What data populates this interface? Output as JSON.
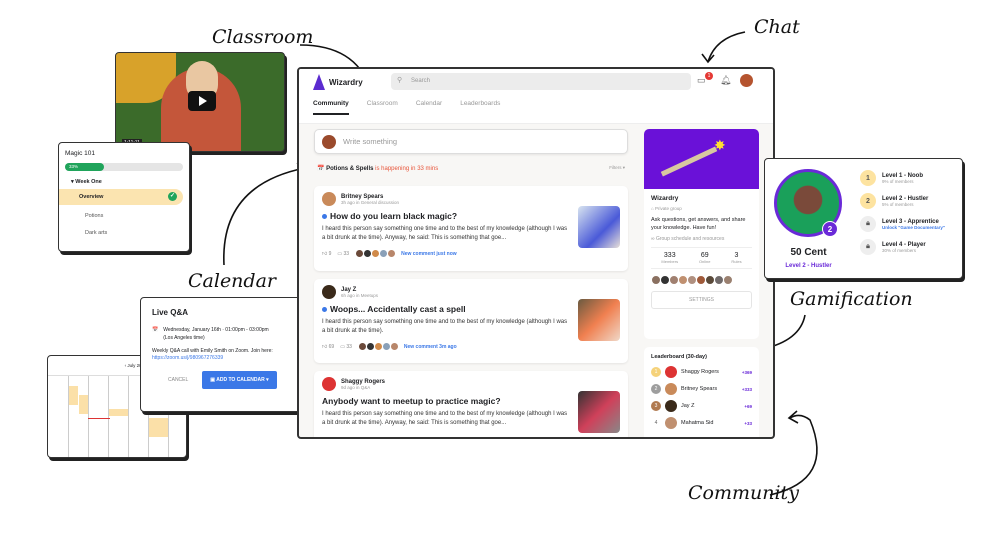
{
  "annotations": {
    "classroom": "Classroom",
    "chat": "Chat",
    "calendar": "Calendar",
    "gamification": "Gamification",
    "community": "Community"
  },
  "video": {
    "duration": "1:11:11"
  },
  "course": {
    "title": "Magic 101",
    "progress_percent": 33,
    "progress_label": "33%",
    "section": "Week One",
    "lessons": [
      {
        "label": "Overview",
        "done": true
      },
      {
        "label": "Potions",
        "done": false
      },
      {
        "label": "Dark arts",
        "done": false
      }
    ]
  },
  "mini_calendar": {
    "month": "July 2021"
  },
  "event_popup": {
    "title": "Live Q&A",
    "datetime": "Wednesday, January 16th · 01:00pm - 03:00pm",
    "timezone": "(Los Angeles time)",
    "description": "Weekly Q&A call with Emily Smith on Zoom. Join here:",
    "link": "https://zoom.us/j/980967276339",
    "cancel": "CANCEL",
    "add": "ADD TO CALENDAR",
    "accent": "#3b78e7"
  },
  "app": {
    "name": "Wizardry",
    "search_placeholder": "Search",
    "chat_badge": "1",
    "tabs": [
      "Community",
      "Classroom",
      "Calendar",
      "Leaderboards"
    ],
    "active_tab": "Community",
    "composer_placeholder": "Write something",
    "event_banner": {
      "name": "Potions & Spells",
      "status": "is happening in 33 mins",
      "filters": "Filters"
    },
    "posts": [
      {
        "author": "Britney Spears",
        "meta": "3h ago in General discussion",
        "title": "How do you learn black magic?",
        "unread": true,
        "body": "I heard this person say something one time and to the best of my knowledge (although I was a bit drunk at the time). Anyway, he said: This is something that goe...",
        "likes": "9",
        "comments": "33",
        "activity": "New comment just now"
      },
      {
        "author": "Jay Z",
        "meta": "6h ago in Meetups",
        "title": "Woops... Accidentally cast a spell",
        "unread": true,
        "body": "I heard this person say something one time and to the best of my knowledge (although I was a bit drunk at the time).",
        "likes": "69",
        "comments": "33",
        "activity": "New comment 3m ago"
      },
      {
        "author": "Shaggy Rogers",
        "meta": "9d ago in Q&A",
        "title": "Anybody want to meetup to practice magic?",
        "unread": false,
        "body": "I heard this person say something one time and to the best of my knowledge (although I was a bit drunk at the time). Anyway, he said: This is something that goe..."
      }
    ],
    "group": {
      "name": "Wizardry",
      "privacy": "Private group",
      "description": "Ask questions, get answers, and share your knowledge. Have fun!",
      "resources": "Group schedule and resources",
      "stats": [
        {
          "value": "333",
          "label": "Members"
        },
        {
          "value": "69",
          "label": "Online"
        },
        {
          "value": "3",
          "label": "Rules"
        }
      ],
      "settings": "SETTINGS",
      "banner_color": "#6a11d8"
    },
    "leaderboard": {
      "title": "Leaderboard (30-day)",
      "rows": [
        {
          "rank": "1",
          "name": "Shaggy Rogers",
          "points": "+369"
        },
        {
          "rank": "2",
          "name": "Britney Spears",
          "points": "+333"
        },
        {
          "rank": "3",
          "name": "Jay Z",
          "points": "+69"
        },
        {
          "rank": "4",
          "name": "Mahatma Sid",
          "points": "+33"
        }
      ]
    }
  },
  "gamification": {
    "user": "50 Cent",
    "user_level": "Level 2 - Hustler",
    "level_badge": "2",
    "levels": [
      {
        "badge": "1",
        "name": "Level 1 - Noob",
        "sub": "9% of members",
        "locked": false
      },
      {
        "badge": "2",
        "name": "Level 2 - Hustler",
        "sub": "5% of members",
        "locked": false
      },
      {
        "badge": "",
        "name": "Level 3 - Apprentice",
        "sub": "Unlock \"Game Documentary\"",
        "locked": true
      },
      {
        "badge": "",
        "name": "Level 4 - Player",
        "sub": "30% of members",
        "locked": true
      }
    ]
  }
}
